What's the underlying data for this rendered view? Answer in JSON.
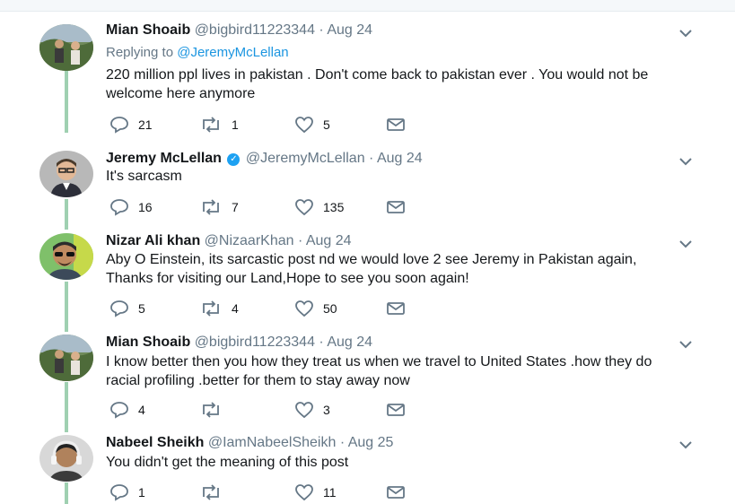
{
  "tweets": [
    {
      "name": "Mian Shoaib",
      "handle": "@bigbird11223344",
      "sep": "·",
      "date": "Aug 24",
      "replying_prefix": "Replying to",
      "replying_to": "@JeremyMcLellan",
      "text": "220 million ppl lives in pakistan . Don't come back to pakistan ever . You would not be welcome here anymore",
      "replies": "21",
      "retweets": "1",
      "likes": "5",
      "avatar": "landscape-photo"
    },
    {
      "name": "Jeremy McLellan",
      "verified": true,
      "handle": "@JeremyMcLellan",
      "sep": "·",
      "date": "Aug 24",
      "text": "It's sarcasm",
      "replies": "16",
      "retweets": "7",
      "likes": "135",
      "avatar": "man-glasses-photo"
    },
    {
      "name": "Nizar Ali khan",
      "handle": "@NizaarKhan",
      "sep": "·",
      "date": "Aug 24",
      "text": "Aby O Einstein, its sarcastic post nd we would love 2 see Jeremy in Pakistan again, Thanks for visiting our Land,Hope to see you soon again!",
      "replies": "5",
      "retweets": "4",
      "likes": "50",
      "avatar": "man-sunglasses-photo"
    },
    {
      "name": "Mian Shoaib",
      "handle": "@bigbird11223344",
      "sep": "·",
      "date": "Aug 24",
      "text": "I know better then you how they treat us when we travel to United States .how they do racial profiling .better for them to stay away now",
      "replies": "4",
      "retweets": "",
      "likes": "3",
      "avatar": "landscape-photo"
    },
    {
      "name": "Nabeel Sheikh",
      "handle": "@IamNabeelSheikh",
      "sep": "·",
      "date": "Aug 25",
      "text": "You didn't get the meaning of this post",
      "replies": "1",
      "retweets": "",
      "likes": "11",
      "avatar": "man-headphones-photo"
    }
  ],
  "colors": {
    "link": "#1b95e0",
    "muted": "#657786",
    "thread": "#9fd0b1",
    "verified": "#1da1f2"
  },
  "icons": [
    "reply-icon",
    "retweet-icon",
    "like-icon",
    "dm-icon",
    "chevron-down-icon",
    "verified-icon"
  ]
}
